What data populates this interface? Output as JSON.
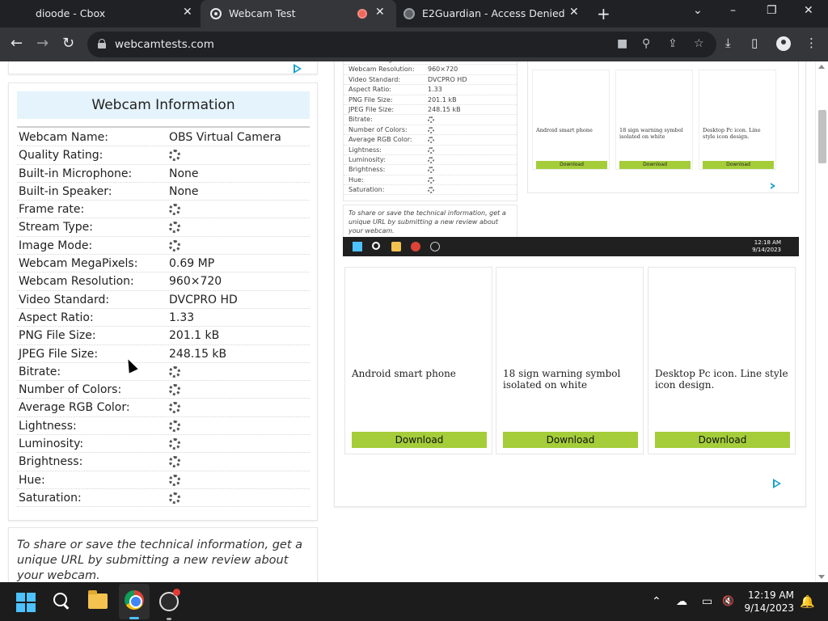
{
  "browser": {
    "tabs": [
      {
        "title": "dioode - Cbox",
        "active": false
      },
      {
        "title": "Webcam Test",
        "active": true,
        "recording": true
      },
      {
        "title": "E2Guardian - Access Denied",
        "active": false
      }
    ],
    "new_tab_icon": "+",
    "url": "webcamtests.com",
    "window_controls": {
      "tab_search": "⌄",
      "minimize": "–",
      "restore": "❐",
      "close": "✕"
    },
    "nav_icons": {
      "back": "←",
      "forward": "→",
      "reload": "↻"
    },
    "omnibox_icons": {
      "camera": "■",
      "zoom": "⚲",
      "share": "⇪",
      "bookmark": "☆"
    },
    "toolbar_icons": {
      "download": "⤓",
      "sidepanel": "▯",
      "menu": "⋮"
    }
  },
  "webcam_info": {
    "title": "Webcam Information",
    "rows": [
      {
        "label": "Webcam Name:",
        "value": "OBS Virtual Camera"
      },
      {
        "label": "Quality Rating:",
        "value": null
      },
      {
        "label": "Built-in Microphone:",
        "value": "None"
      },
      {
        "label": "Built-in Speaker:",
        "value": "None"
      },
      {
        "label": "Frame rate:",
        "value": null
      },
      {
        "label": "Stream Type:",
        "value": null
      },
      {
        "label": "Image Mode:",
        "value": null
      },
      {
        "label": "Webcam MegaPixels:",
        "value": "0.69 MP"
      },
      {
        "label": "Webcam Resolution:",
        "value": "960×720"
      },
      {
        "label": "Video Standard:",
        "value": "DVCPRO HD"
      },
      {
        "label": "Aspect Ratio:",
        "value": "1.33"
      },
      {
        "label": "PNG File Size:",
        "value": "201.1 kB"
      },
      {
        "label": "JPEG File Size:",
        "value": "248.15 kB"
      },
      {
        "label": "Bitrate:",
        "value": null
      },
      {
        "label": "Number of Colors:",
        "value": null
      },
      {
        "label": "Average RGB Color:",
        "value": null
      },
      {
        "label": "Lightness:",
        "value": null
      },
      {
        "label": "Luminosity:",
        "value": null
      },
      {
        "label": "Brightness:",
        "value": null
      },
      {
        "label": "Hue:",
        "value": null
      },
      {
        "label": "Saturation:",
        "value": null
      }
    ]
  },
  "share_note": "To share or save the technical information, get a unique URL by submitting a new review about your webcam.",
  "webcam_preview": {
    "rows": [
      {
        "label": "Webcam MegaPixels:",
        "value": "0.69 MP"
      },
      {
        "label": "Webcam Resolution:",
        "value": "960×720"
      },
      {
        "label": "Video Standard:",
        "value": "DVCPRO HD"
      },
      {
        "label": "Aspect Ratio:",
        "value": "1.33"
      },
      {
        "label": "PNG File Size:",
        "value": "201.1 kB"
      },
      {
        "label": "JPEG File Size:",
        "value": "248.15 kB"
      },
      {
        "label": "Bitrate:",
        "value": null
      },
      {
        "label": "Number of Colors:",
        "value": null
      },
      {
        "label": "Average RGB Color:",
        "value": null
      },
      {
        "label": "Lightness:",
        "value": null
      },
      {
        "label": "Luminosity:",
        "value": null
      },
      {
        "label": "Brightness:",
        "value": null
      },
      {
        "label": "Hue:",
        "value": null
      },
      {
        "label": "Saturation:",
        "value": null
      }
    ],
    "share_note": "To share or save the technical information, get a unique URL by submitting a new review about your webcam.",
    "ads": [
      {
        "title": "Android smart phone",
        "button": "Download"
      },
      {
        "title": "18 sign warning symbol isolated on white",
        "button": "Download"
      },
      {
        "title": "Desktop Pc icon. Line style icon design.",
        "button": "Download"
      }
    ],
    "taskbar_time": "12:18 AM",
    "taskbar_date": "9/14/2023"
  },
  "ads": [
    {
      "title": "Android smart phone",
      "button": "Download"
    },
    {
      "title": "18 sign warning symbol isolated on white",
      "button": "Download"
    },
    {
      "title": "Desktop Pc icon. Line style icon design.",
      "button": "Download"
    }
  ],
  "taskbar": {
    "time": "12:19 AM",
    "date": "9/14/2023",
    "tray_icons": {
      "chevron": "⌃",
      "onedrive": "☁",
      "network": "▭",
      "volume": "🔇",
      "notifications": "🔔"
    }
  },
  "colors": {
    "accent_header": "#e5f3fc",
    "download_button": "#a4cd39",
    "adchoices": "#19a0c9",
    "taskbar": "#1c1c1c",
    "tab_bar": "#202124"
  }
}
